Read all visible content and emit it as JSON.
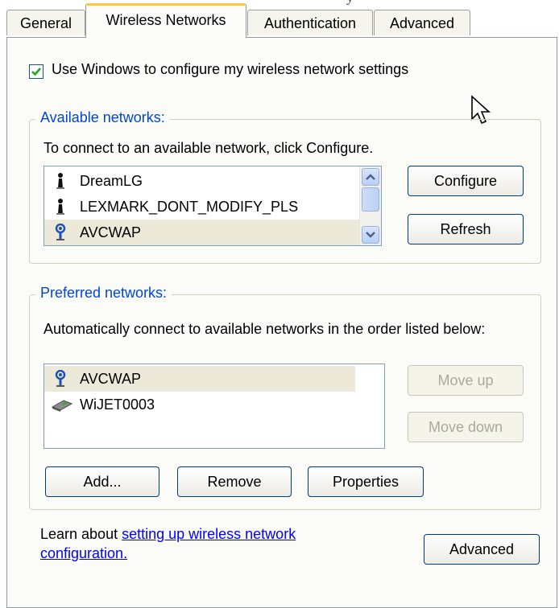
{
  "tabs": [
    {
      "label": "General"
    },
    {
      "label": "Wireless Networks"
    },
    {
      "label": "Authentication"
    },
    {
      "label": "Advanced"
    }
  ],
  "use_windows_checkbox": {
    "label": "Use Windows to configure my wireless network settings",
    "checked": true
  },
  "available": {
    "legend": "Available networks:",
    "instruction": "To connect to an available network, click Configure.",
    "networks": [
      {
        "name": "DreamLG",
        "icon": "antenna-icon"
      },
      {
        "name": "LEXMARK_DONT_MODIFY_PLS",
        "icon": "antenna-icon"
      },
      {
        "name": "AVCWAP",
        "icon": "wireless-signal-icon",
        "selected": true
      }
    ],
    "configure_label": "Configure",
    "refresh_label": "Refresh"
  },
  "preferred": {
    "legend": "Preferred networks:",
    "instruction": "Automatically connect to available networks in the order listed below:",
    "networks": [
      {
        "name": "AVCWAP",
        "icon": "wireless-signal-icon",
        "selected": true
      },
      {
        "name": "WiJET0003",
        "icon": "adhoc-card-icon"
      }
    ],
    "move_up_label": "Move up",
    "move_down_label": "Move down",
    "add_label": "Add...",
    "remove_label": "Remove",
    "properties_label": "Properties"
  },
  "learn": {
    "prefix": "Learn about ",
    "link_line1": "setting up wireless network",
    "link_line2": "configuration."
  },
  "advanced_label": "Advanced",
  "colors": {
    "legend": "#0046d5",
    "link": "#0000ff",
    "active_tab_accent": "#ffc83c"
  }
}
